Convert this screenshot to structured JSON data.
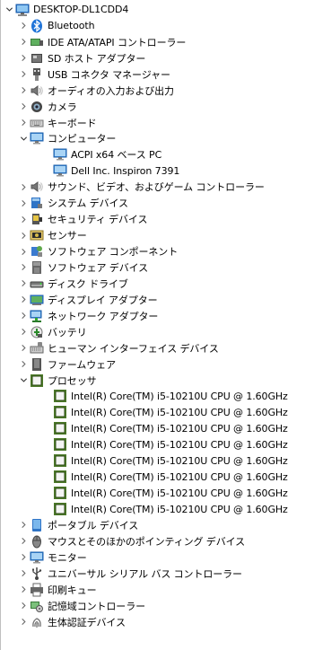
{
  "root": {
    "label": "DESKTOP-DL1CDD4",
    "icon": "computer-root-icon"
  },
  "categories": [
    {
      "label": "Bluetooth",
      "icon": "bluetooth-icon",
      "expanded": false
    },
    {
      "label": "IDE ATA/ATAPI コントローラー",
      "icon": "ide-controller-icon",
      "expanded": false
    },
    {
      "label": "SD ホスト アダプター",
      "icon": "sd-host-icon",
      "expanded": false
    },
    {
      "label": "USB コネクタ マネージャー",
      "icon": "usb-connector-icon",
      "expanded": false
    },
    {
      "label": "オーディオの入力および出力",
      "icon": "speaker-icon",
      "expanded": false
    },
    {
      "label": "カメラ",
      "icon": "camera-icon",
      "expanded": false
    },
    {
      "label": "キーボード",
      "icon": "keyboard-icon",
      "expanded": false
    },
    {
      "label": "コンピューター",
      "icon": "monitor-icon",
      "expanded": true,
      "children": [
        {
          "label": "ACPI x64 ベース PC",
          "icon": "monitor-icon"
        },
        {
          "label": "Dell Inc. Inspiron 7391",
          "icon": "monitor-icon"
        }
      ]
    },
    {
      "label": "サウンド、ビデオ、およびゲーム コントローラー",
      "icon": "speaker-icon",
      "expanded": false
    },
    {
      "label": "システム デバイス",
      "icon": "system-device-icon",
      "expanded": false
    },
    {
      "label": "セキュリティ デバイス",
      "icon": "security-device-icon",
      "expanded": false
    },
    {
      "label": "センサー",
      "icon": "sensor-icon",
      "expanded": false
    },
    {
      "label": "ソフトウェア コンポーネント",
      "icon": "software-component-icon",
      "expanded": false
    },
    {
      "label": "ソフトウェア デバイス",
      "icon": "software-device-icon",
      "expanded": false
    },
    {
      "label": "ディスク ドライブ",
      "icon": "disk-drive-icon",
      "expanded": false
    },
    {
      "label": "ディスプレイ アダプター",
      "icon": "display-adapter-icon",
      "expanded": false
    },
    {
      "label": "ネットワーク アダプター",
      "icon": "network-adapter-icon",
      "expanded": false
    },
    {
      "label": "バッテリ",
      "icon": "battery-icon",
      "expanded": false
    },
    {
      "label": "ヒューマン インターフェイス デバイス",
      "icon": "hid-icon",
      "expanded": false
    },
    {
      "label": "ファームウェア",
      "icon": "firmware-icon",
      "expanded": false
    },
    {
      "label": "プロセッサ",
      "icon": "processor-icon",
      "expanded": true,
      "children": [
        {
          "label": "Intel(R) Core(TM) i5-10210U CPU @ 1.60GHz",
          "icon": "processor-icon"
        },
        {
          "label": "Intel(R) Core(TM) i5-10210U CPU @ 1.60GHz",
          "icon": "processor-icon"
        },
        {
          "label": "Intel(R) Core(TM) i5-10210U CPU @ 1.60GHz",
          "icon": "processor-icon"
        },
        {
          "label": "Intel(R) Core(TM) i5-10210U CPU @ 1.60GHz",
          "icon": "processor-icon"
        },
        {
          "label": "Intel(R) Core(TM) i5-10210U CPU @ 1.60GHz",
          "icon": "processor-icon"
        },
        {
          "label": "Intel(R) Core(TM) i5-10210U CPU @ 1.60GHz",
          "icon": "processor-icon"
        },
        {
          "label": "Intel(R) Core(TM) i5-10210U CPU @ 1.60GHz",
          "icon": "processor-icon"
        },
        {
          "label": "Intel(R) Core(TM) i5-10210U CPU @ 1.60GHz",
          "icon": "processor-icon"
        }
      ]
    },
    {
      "label": "ポータブル デバイス",
      "icon": "portable-device-icon",
      "expanded": false
    },
    {
      "label": "マウスとそのほかのポインティング デバイス",
      "icon": "mouse-icon",
      "expanded": false
    },
    {
      "label": "モニター",
      "icon": "monitor-icon",
      "expanded": false
    },
    {
      "label": "ユニバーサル シリアル バス コントローラー",
      "icon": "usb-icon",
      "expanded": false
    },
    {
      "label": "印刷キュー",
      "icon": "printer-icon",
      "expanded": false
    },
    {
      "label": "記憶域コントローラー",
      "icon": "storage-controller-icon",
      "expanded": false
    },
    {
      "label": "生体認証デバイス",
      "icon": "biometric-icon",
      "expanded": false
    }
  ]
}
